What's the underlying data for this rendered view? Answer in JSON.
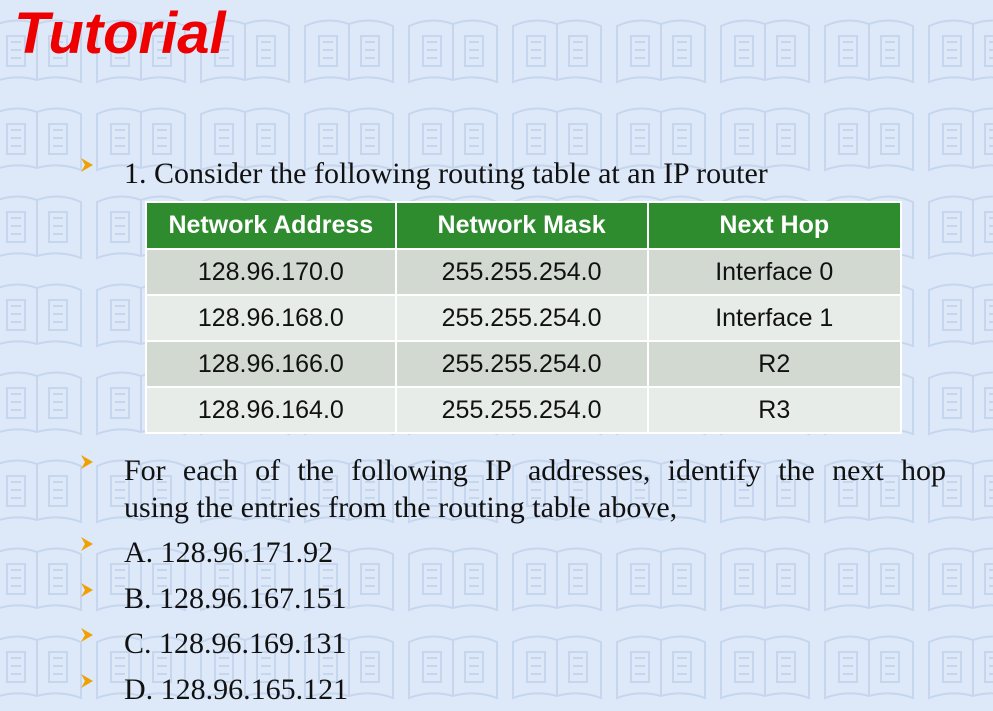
{
  "slide": {
    "title": "Tutorial",
    "question_intro": "1. Consider the following routing table at an IP router",
    "instruction_line1": "For each of the following IP addresses, identify the next hop",
    "instruction_line2": "using the entries from the routing table above,",
    "options": [
      "A. 128.96.171.92",
      "B. 128.96.167.151",
      "C. 128.96.169.131",
      "D. 128.96.165.121"
    ]
  },
  "routing_table": {
    "headers": [
      "Network Address",
      "Network Mask",
      "Next Hop"
    ],
    "rows": [
      [
        "128.96.170.0",
        "255.255.254.0",
        "Interface 0"
      ],
      [
        "128.96.168.0",
        "255.255.254.0",
        "Interface 1"
      ],
      [
        "128.96.166.0",
        "255.255.254.0",
        "R2"
      ],
      [
        "128.96.164.0",
        "255.255.254.0",
        "R3"
      ]
    ]
  },
  "icons": {
    "bullet": "arrowhead-bullet-icon",
    "background": "book-watermark-pattern"
  },
  "colors": {
    "title": "#ee0000",
    "table_header": "#2e8b2e",
    "bullet": "#f0a000",
    "background": "#dde9f8"
  }
}
